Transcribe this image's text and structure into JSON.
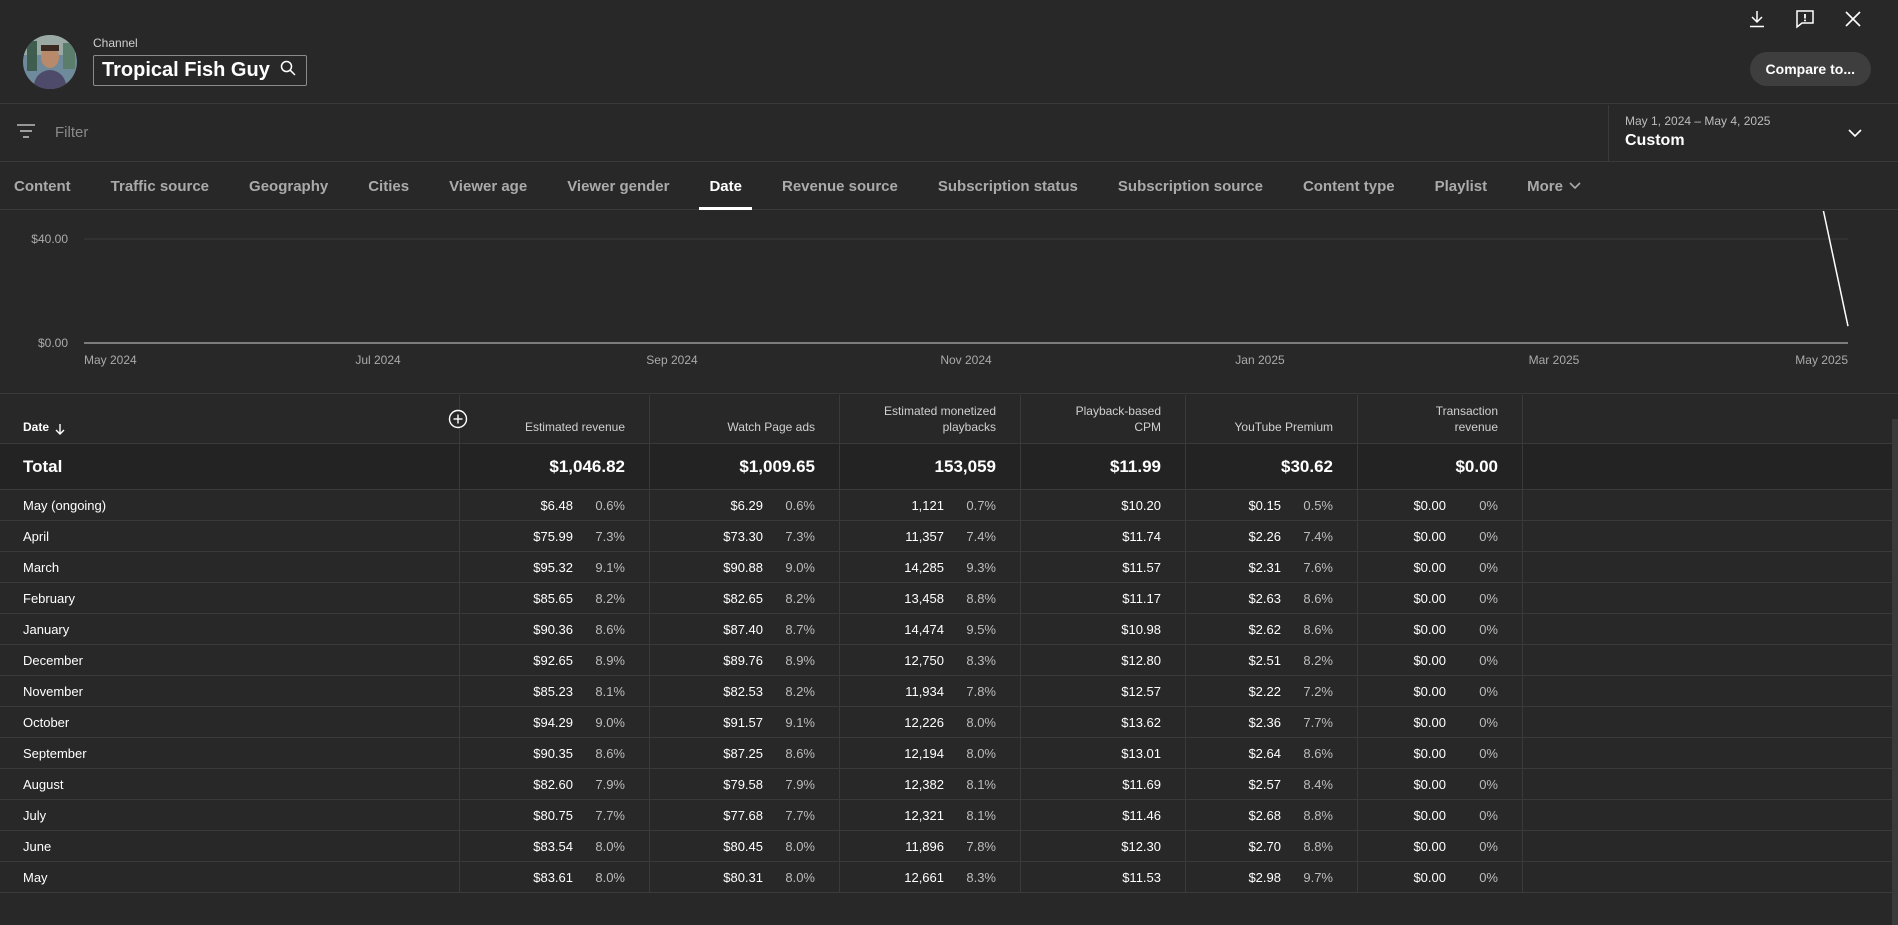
{
  "header": {
    "channel_label": "Channel",
    "channel_name": "Tropical Fish Guy",
    "compare_label": "Compare to..."
  },
  "filter": {
    "placeholder": "Filter"
  },
  "date_range": {
    "range_text": "May 1, 2024 – May 4, 2025",
    "preset": "Custom"
  },
  "tabs": [
    "Content",
    "Traffic source",
    "Geography",
    "Cities",
    "Viewer age",
    "Viewer gender",
    "Date",
    "Revenue source",
    "Subscription status",
    "Subscription source",
    "Content type",
    "Playlist"
  ],
  "tab_more": "More",
  "active_tab": "Date",
  "chart_data": {
    "type": "line",
    "x_tick_labels": [
      "May 2024",
      "Jul 2024",
      "Sep 2024",
      "Nov 2024",
      "Jan 2025",
      "Mar 2025",
      "May 2025"
    ],
    "y_tick_labels": [
      "$40.00",
      "$0.00"
    ],
    "ylim": [
      0,
      50
    ],
    "series": [
      {
        "x": [
          "2025-04-28",
          "2025-05-04"
        ],
        "y": [
          100,
          6.48
        ]
      }
    ]
  },
  "table": {
    "headers": {
      "date": "Date",
      "est_revenue": "Estimated revenue",
      "watch_ads": "Watch Page ads",
      "monetized_1": "Estimated monetized",
      "monetized_2": "playbacks",
      "cpm_1": "Playback-based",
      "cpm_2": "CPM",
      "premium": "YouTube Premium",
      "txn_1": "Transaction",
      "txn_2": "revenue"
    },
    "total": {
      "label": "Total",
      "est_revenue": "$1,046.82",
      "watch_ads": "$1,009.65",
      "monetized": "153,059",
      "cpm": "$11.99",
      "premium": "$30.62",
      "txn": "$0.00"
    },
    "rows": [
      {
        "date": "May (ongoing)",
        "rev": "$6.48",
        "rev_pct": "0.6%",
        "ads": "$6.29",
        "ads_pct": "0.6%",
        "mon": "1,121",
        "mon_pct": "0.7%",
        "cpm": "$10.20",
        "prem": "$0.15",
        "prem_pct": "0.5%",
        "txn": "$0.00",
        "txn_pct": "0%"
      },
      {
        "date": "April",
        "rev": "$75.99",
        "rev_pct": "7.3%",
        "ads": "$73.30",
        "ads_pct": "7.3%",
        "mon": "11,357",
        "mon_pct": "7.4%",
        "cpm": "$11.74",
        "prem": "$2.26",
        "prem_pct": "7.4%",
        "txn": "$0.00",
        "txn_pct": "0%"
      },
      {
        "date": "March",
        "rev": "$95.32",
        "rev_pct": "9.1%",
        "ads": "$90.88",
        "ads_pct": "9.0%",
        "mon": "14,285",
        "mon_pct": "9.3%",
        "cpm": "$11.57",
        "prem": "$2.31",
        "prem_pct": "7.6%",
        "txn": "$0.00",
        "txn_pct": "0%"
      },
      {
        "date": "February",
        "rev": "$85.65",
        "rev_pct": "8.2%",
        "ads": "$82.65",
        "ads_pct": "8.2%",
        "mon": "13,458",
        "mon_pct": "8.8%",
        "cpm": "$11.17",
        "prem": "$2.63",
        "prem_pct": "8.6%",
        "txn": "$0.00",
        "txn_pct": "0%"
      },
      {
        "date": "January",
        "rev": "$90.36",
        "rev_pct": "8.6%",
        "ads": "$87.40",
        "ads_pct": "8.7%",
        "mon": "14,474",
        "mon_pct": "9.5%",
        "cpm": "$10.98",
        "prem": "$2.62",
        "prem_pct": "8.6%",
        "txn": "$0.00",
        "txn_pct": "0%"
      },
      {
        "date": "December",
        "rev": "$92.65",
        "rev_pct": "8.9%",
        "ads": "$89.76",
        "ads_pct": "8.9%",
        "mon": "12,750",
        "mon_pct": "8.3%",
        "cpm": "$12.80",
        "prem": "$2.51",
        "prem_pct": "8.2%",
        "txn": "$0.00",
        "txn_pct": "0%"
      },
      {
        "date": "November",
        "rev": "$85.23",
        "rev_pct": "8.1%",
        "ads": "$82.53",
        "ads_pct": "8.2%",
        "mon": "11,934",
        "mon_pct": "7.8%",
        "cpm": "$12.57",
        "prem": "$2.22",
        "prem_pct": "7.2%",
        "txn": "$0.00",
        "txn_pct": "0%"
      },
      {
        "date": "October",
        "rev": "$94.29",
        "rev_pct": "9.0%",
        "ads": "$91.57",
        "ads_pct": "9.1%",
        "mon": "12,226",
        "mon_pct": "8.0%",
        "cpm": "$13.62",
        "prem": "$2.36",
        "prem_pct": "7.7%",
        "txn": "$0.00",
        "txn_pct": "0%"
      },
      {
        "date": "September",
        "rev": "$90.35",
        "rev_pct": "8.6%",
        "ads": "$87.25",
        "ads_pct": "8.6%",
        "mon": "12,194",
        "mon_pct": "8.0%",
        "cpm": "$13.01",
        "prem": "$2.64",
        "prem_pct": "8.6%",
        "txn": "$0.00",
        "txn_pct": "0%"
      },
      {
        "date": "August",
        "rev": "$82.60",
        "rev_pct": "7.9%",
        "ads": "$79.58",
        "ads_pct": "7.9%",
        "mon": "12,382",
        "mon_pct": "8.1%",
        "cpm": "$11.69",
        "prem": "$2.57",
        "prem_pct": "8.4%",
        "txn": "$0.00",
        "txn_pct": "0%"
      },
      {
        "date": "July",
        "rev": "$80.75",
        "rev_pct": "7.7%",
        "ads": "$77.68",
        "ads_pct": "7.7%",
        "mon": "12,321",
        "mon_pct": "8.1%",
        "cpm": "$11.46",
        "prem": "$2.68",
        "prem_pct": "8.8%",
        "txn": "$0.00",
        "txn_pct": "0%"
      },
      {
        "date": "June",
        "rev": "$83.54",
        "rev_pct": "8.0%",
        "ads": "$80.45",
        "ads_pct": "8.0%",
        "mon": "11,896",
        "mon_pct": "7.8%",
        "cpm": "$12.30",
        "prem": "$2.70",
        "prem_pct": "8.8%",
        "txn": "$0.00",
        "txn_pct": "0%"
      },
      {
        "date": "May",
        "rev": "$83.61",
        "rev_pct": "8.0%",
        "ads": "$80.31",
        "ads_pct": "8.0%",
        "mon": "12,661",
        "mon_pct": "8.3%",
        "cpm": "$11.53",
        "prem": "$2.98",
        "prem_pct": "9.7%",
        "txn": "$0.00",
        "txn_pct": "0%"
      }
    ]
  }
}
